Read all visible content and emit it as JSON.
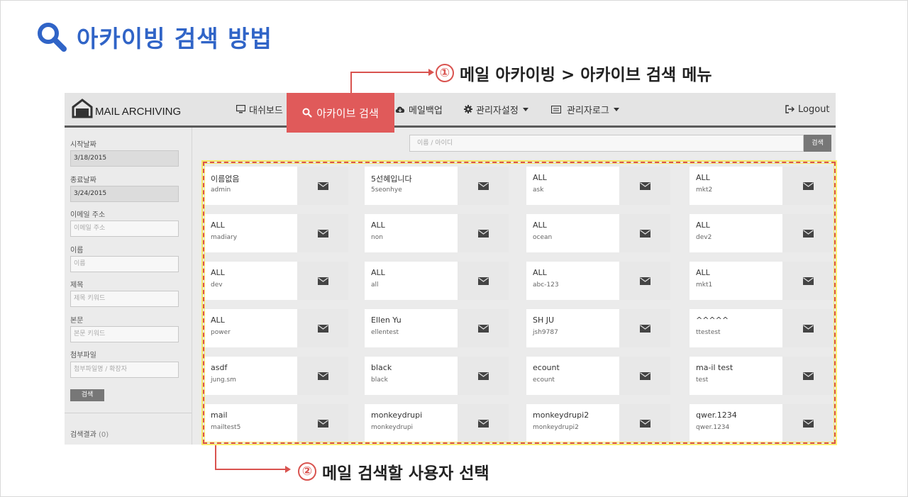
{
  "slide": {
    "title": "아카이빙 검색 방법",
    "callout1": {
      "num": "①",
      "text": "메일 아카이빙 > 아카이브 검색 메뉴"
    },
    "callout2": {
      "num": "②",
      "text": "메일 검색할 사용자 선택"
    }
  },
  "app": {
    "logo": "MAIL ARCHIVING",
    "nav": {
      "dashboard": "대쉬보드",
      "archive_search": "아카이브 검색",
      "mail_backup": "메일백업",
      "admin_settings": "관리자설정",
      "admin_log": "관리자로그",
      "logout": "Logout"
    },
    "sidebar": {
      "start_date_label": "시작날짜",
      "start_date_value": "3/18/2015",
      "end_date_label": "종료날짜",
      "end_date_value": "3/24/2015",
      "email_label": "이메일 주소",
      "email_placeholder": "이메일 주소",
      "name_label": "이름",
      "name_placeholder": "이름",
      "subject_label": "제목",
      "subject_placeholder": "제목 키워드",
      "body_label": "본문",
      "body_placeholder": "본문 키워드",
      "attach_label": "첨부파일",
      "attach_placeholder": "첨부파일명 / 확장자",
      "search_button": "검색",
      "result_label": "검색결과",
      "result_count": "(0)"
    },
    "search": {
      "placeholder": "이름 / 아이디",
      "button": "검색"
    },
    "users": [
      {
        "name": "이름없음",
        "id": "admin"
      },
      {
        "name": "5선혜입니다",
        "id": "5seonhye"
      },
      {
        "name": "ALL",
        "id": "ask"
      },
      {
        "name": "ALL",
        "id": "mkt2"
      },
      {
        "name": "ALL",
        "id": "madiary"
      },
      {
        "name": "ALL",
        "id": "non"
      },
      {
        "name": "ALL",
        "id": "ocean"
      },
      {
        "name": "ALL",
        "id": "dev2"
      },
      {
        "name": "ALL",
        "id": "dev"
      },
      {
        "name": "ALL",
        "id": "all"
      },
      {
        "name": "ALL",
        "id": "abc-123"
      },
      {
        "name": "ALL",
        "id": "mkt1"
      },
      {
        "name": "ALL",
        "id": "power"
      },
      {
        "name": "Ellen Yu",
        "id": "ellentest"
      },
      {
        "name": "SH JU",
        "id": "jsh9787"
      },
      {
        "name": "^^^^^",
        "id": "ttestest"
      },
      {
        "name": "asdf",
        "id": "jung.sm"
      },
      {
        "name": "black",
        "id": "black"
      },
      {
        "name": "ecount",
        "id": "ecount"
      },
      {
        "name": "ma-il test",
        "id": "test"
      },
      {
        "name": "mail",
        "id": "mailtest5"
      },
      {
        "name": "monkeydrupi",
        "id": "monkeydrupi"
      },
      {
        "name": "monkeydrupi2",
        "id": "monkeydrupi2"
      },
      {
        "name": "qwer.1234",
        "id": "qwer.1234"
      }
    ]
  },
  "colors": {
    "title_blue": "#3064c7",
    "accent_red": "#e05a5a",
    "callout_red": "#d9534f"
  }
}
